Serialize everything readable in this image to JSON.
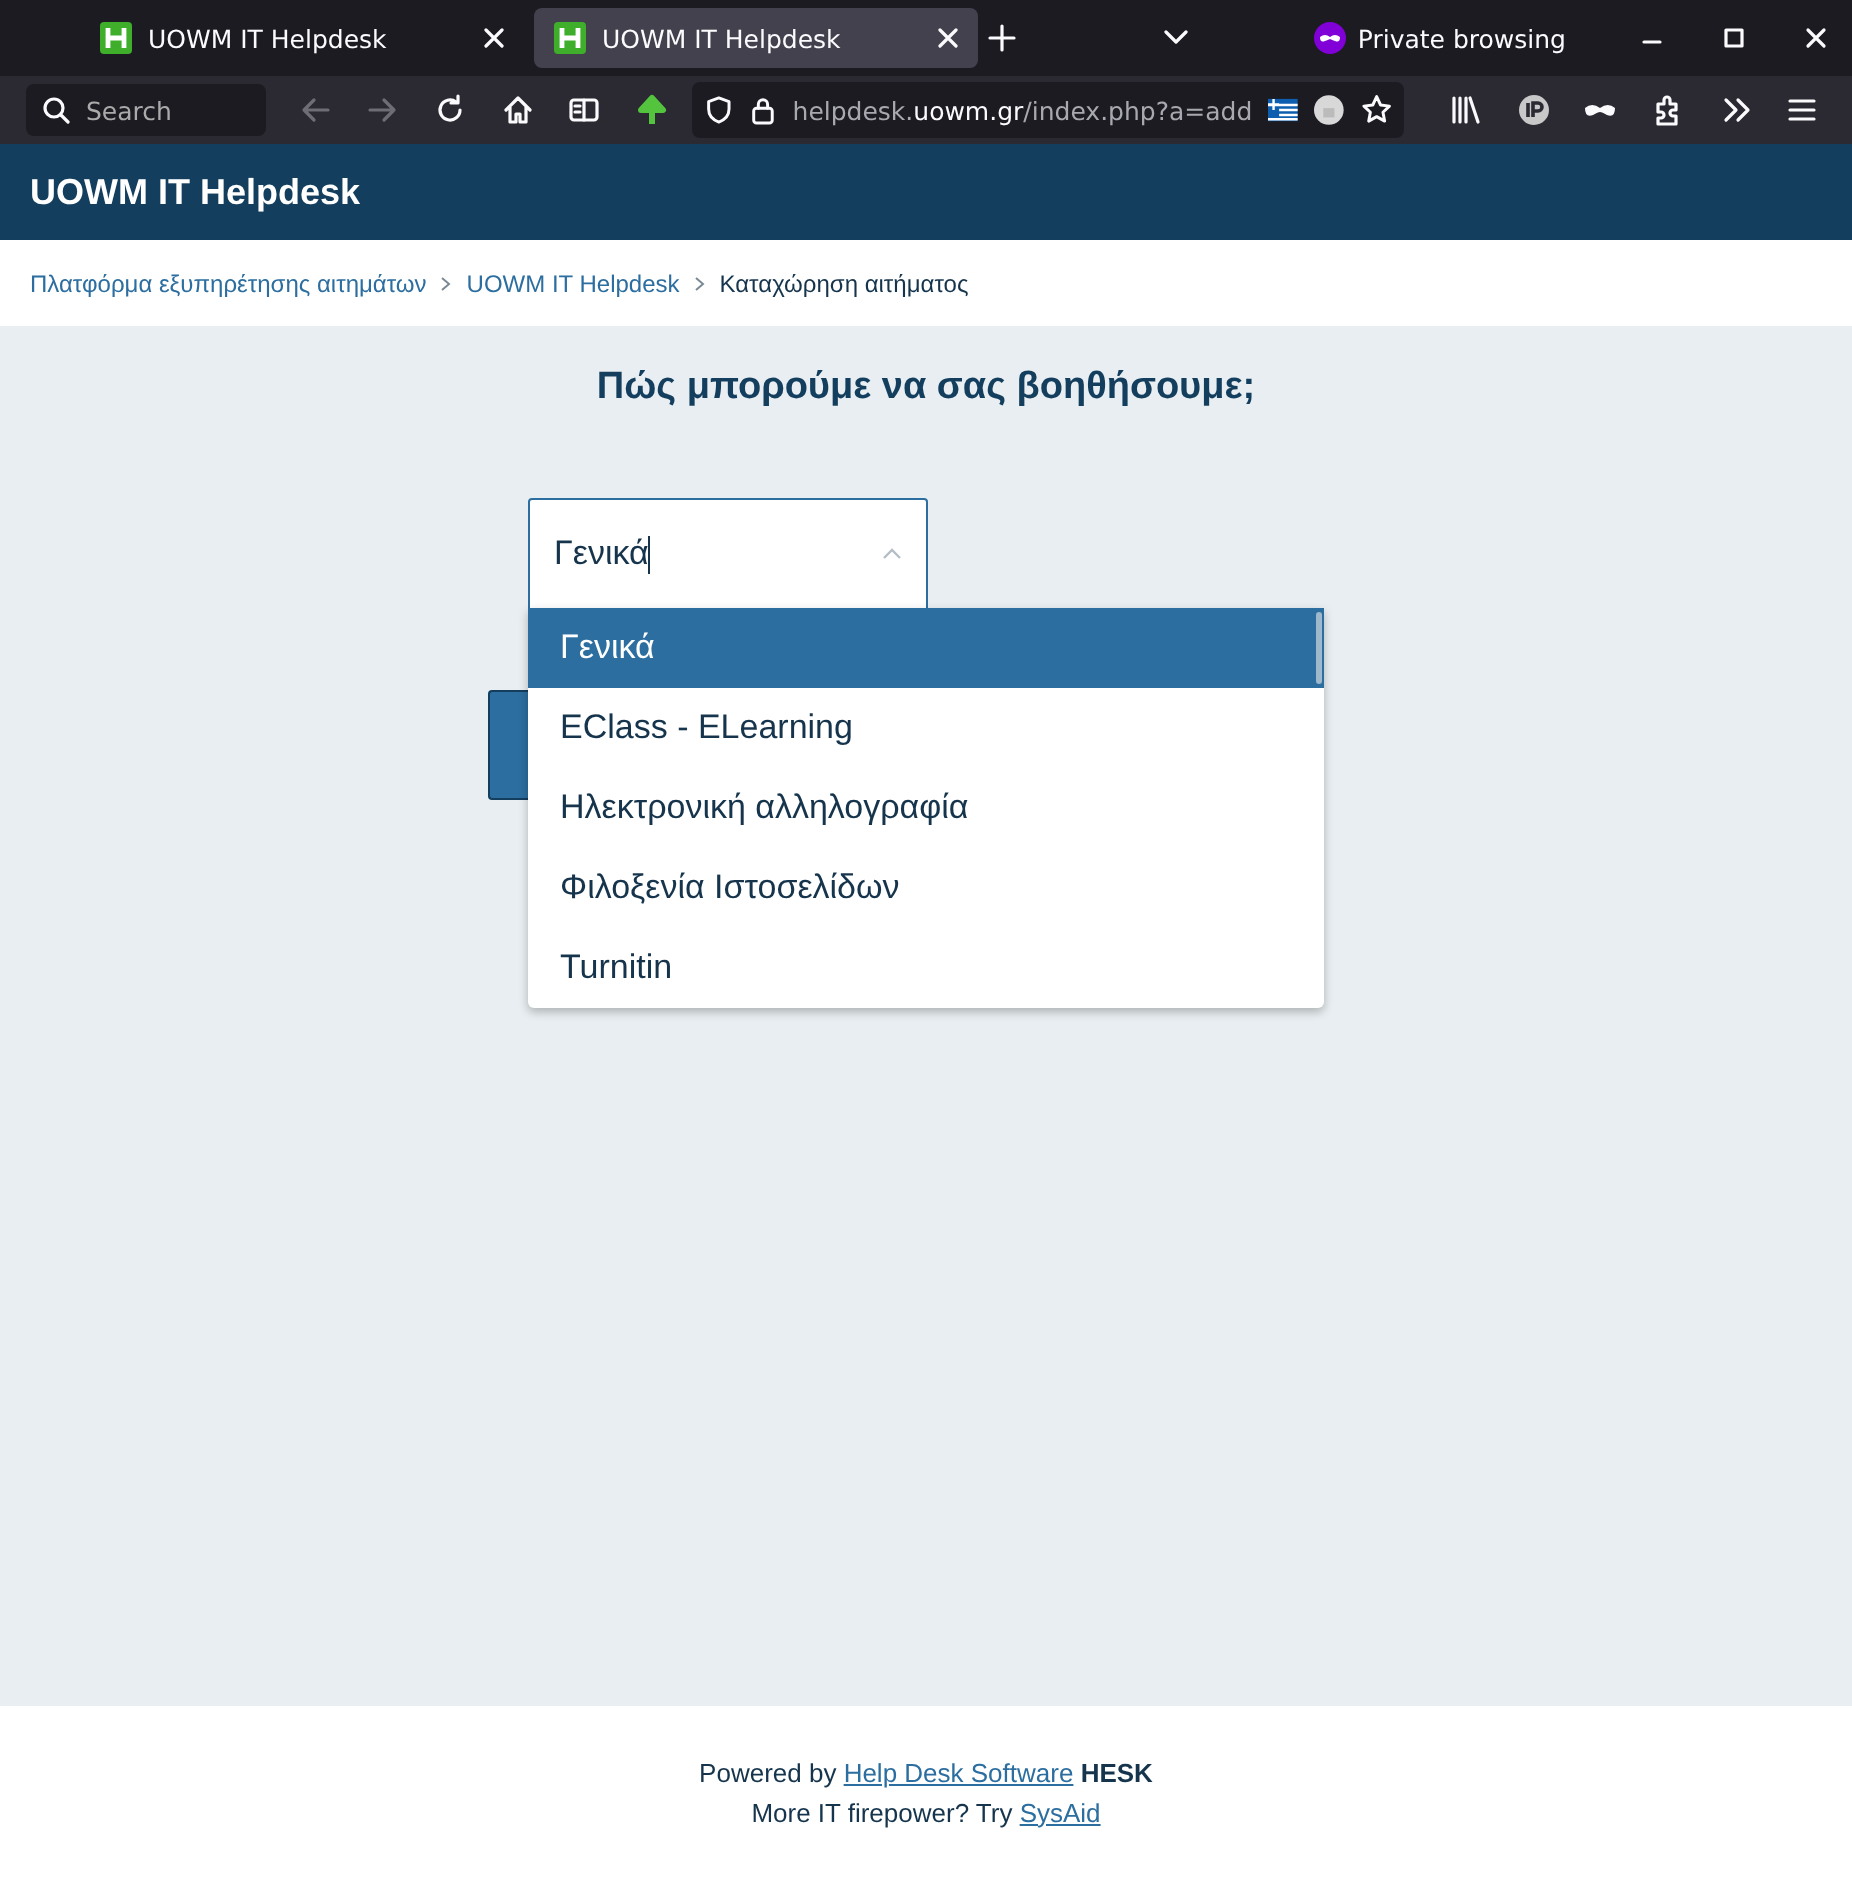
{
  "browser": {
    "tabs": [
      {
        "title": "UOWM IT Helpdesk",
        "selected": false
      },
      {
        "title": "UOWM IT Helpdesk",
        "selected": true
      }
    ],
    "private_label": "Private browsing",
    "search_placeholder": "Search",
    "back_disabled": true,
    "forward_disabled": true,
    "url": {
      "prefix": "helpdesk.",
      "domain": "uowm.gr",
      "rest": "/index.php?a=add"
    }
  },
  "site_title": "UOWM IT Helpdesk",
  "breadcrumbs": [
    {
      "label": "Πλατφόρμα εξυπηρέτησης αιτημάτων",
      "current": false
    },
    {
      "label": "UOWM IT Helpdesk",
      "current": false
    },
    {
      "label": "Καταχώρηση αιτήματος",
      "current": true
    }
  ],
  "heading": "Πώς μπορούμε να σας βοηθήσουμε;",
  "category_select": {
    "value": "Γενικά",
    "expanded": true,
    "options": [
      {
        "label": "Γενικά",
        "selected": true
      },
      {
        "label": "EClass - ELearning",
        "selected": false
      },
      {
        "label": "Ηλεκτρονική αλληλογραφία",
        "selected": false
      },
      {
        "label": "Φιλοξενία Ιστοσελίδων",
        "selected": false
      },
      {
        "label": "Turnitin",
        "selected": false
      }
    ]
  },
  "footer": {
    "lines": [
      {
        "before": "Powered by",
        "link": "Help Desk Software",
        "after": "**HESK**"
      },
      {
        "before": "More IT firepower? Try",
        "link": "SysAid"
      }
    ]
  }
}
